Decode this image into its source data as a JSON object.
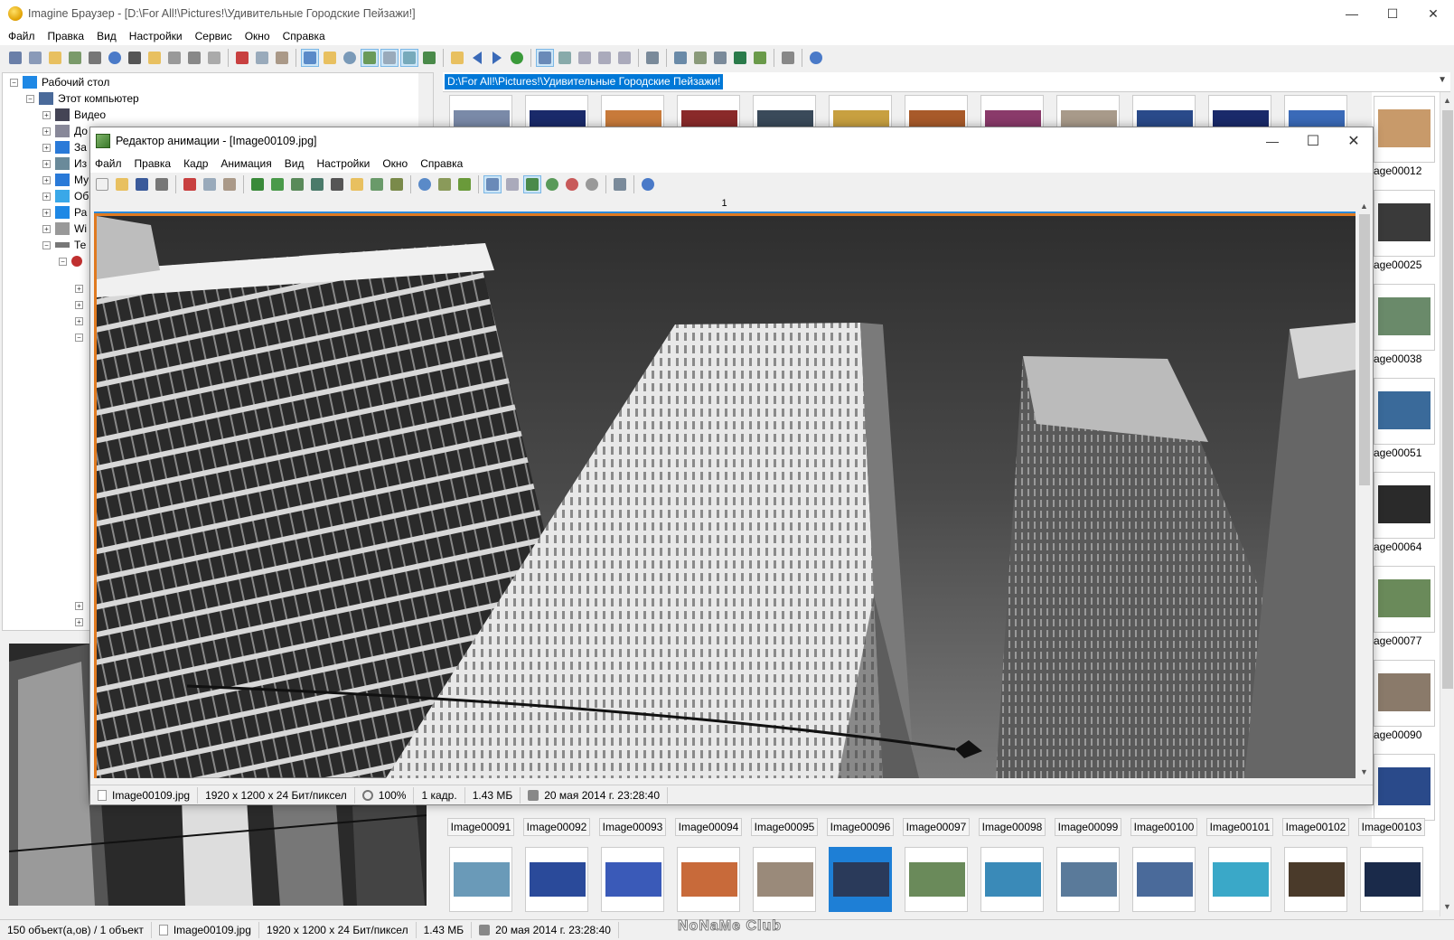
{
  "window": {
    "title": "Imagine Браузер - [D:\\For All!\\Pictures!\\Удивительные Городские Пейзажи!]",
    "minimize": "—",
    "maximize": "☐",
    "close": "✕"
  },
  "menu": [
    "Файл",
    "Правка",
    "Вид",
    "Настройки",
    "Сервис",
    "Окно",
    "Справка"
  ],
  "tree": {
    "root": "Рабочий стол",
    "computer": "Этот компьютер",
    "items": [
      "Видео",
      "До",
      "За",
      "Из",
      "Му",
      "Об",
      "Ра",
      "Wi",
      "Те"
    ]
  },
  "address": {
    "path": "D:\\For All!\\Pictures!\\Удивительные Городские Пейзажи!"
  },
  "grid": {
    "row_labels": [
      "Image00091",
      "Image00092",
      "Image00093",
      "Image00094",
      "Image00095",
      "Image00096",
      "Image00097",
      "Image00098",
      "Image00099",
      "Image00100",
      "Image00101",
      "Image00102",
      "Image00103"
    ],
    "right_labels": [
      "age00012",
      "age00025",
      "age00038",
      "age00051",
      "age00064",
      "age00077",
      "age00090"
    ],
    "selected_index": 5
  },
  "status": {
    "count": "150 объект(а,ов) / 1 объект",
    "file": "Image00109.jpg",
    "dims": "1920 x 1200 x 24 Бит/пиксел",
    "size": "1.43 МБ",
    "date": "20 мая 2014 г. 23:28:40"
  },
  "watermark": "NoNaMe Club",
  "child": {
    "title": "Редактор анимации - [Image00109.jpg]",
    "menu": [
      "Файл",
      "Правка",
      "Кадр",
      "Анимация",
      "Вид",
      "Настройки",
      "Окно",
      "Справка"
    ],
    "frame_number": "1",
    "status": {
      "file": "Image00109.jpg",
      "dims": "1920 x 1200 x 24 Бит/пиксел",
      "zoom": "100%",
      "frames": "1 кадр.",
      "size": "1.43 МБ",
      "date": "20 мая 2014 г. 23:28:40"
    }
  }
}
